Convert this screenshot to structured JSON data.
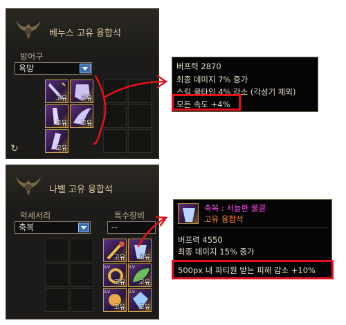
{
  "panel1": {
    "title": "베누스 고유 융합석",
    "category": "방어구",
    "selected": "욕망",
    "item_tag": "고유",
    "refresh_icon": "↻"
  },
  "tooltip1": {
    "line1": "버프력 2870",
    "line2": "최종 데미지 7% 증가",
    "line3": "스킬 쿨타임 4% 감소 (각성기 제외)",
    "line4": "모든 속도 +4%"
  },
  "panel2": {
    "title": "나벨 고유 융합석",
    "category_left": "악세서리",
    "category_right": "특수장비",
    "selected_left": "축복",
    "selected_right": "--",
    "item_tag": "고유",
    "lv_tag": "Lv"
  },
  "tooltip2": {
    "name": "축복 : 서늘한 물결",
    "grade": "고유 융합석",
    "line1": "버프력 4550",
    "line2": "최종 데미지 15% 증가",
    "line3": "500px 내 파티원 받는 피해 감소 +10%"
  },
  "colors": {
    "highlight": "#e8101a",
    "name_magenta": "#ff4cf0",
    "grade_orange": "#ff8a2a"
  }
}
